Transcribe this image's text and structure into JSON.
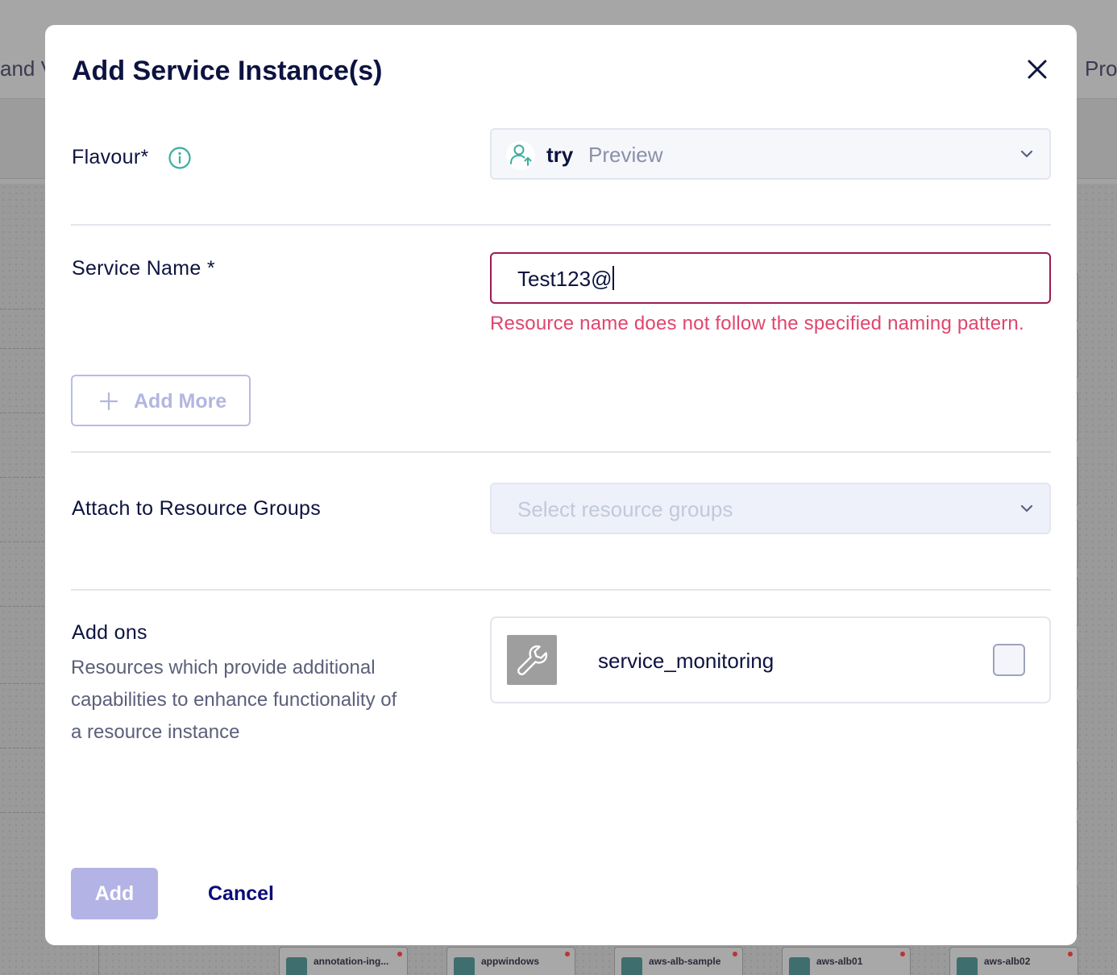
{
  "background": {
    "left_text": "and V",
    "right_text": "Pro",
    "nodes": [
      {
        "label": "annotation-ing..."
      },
      {
        "label": "appwindows"
      },
      {
        "label": "aws-alb-sample"
      },
      {
        "label": "aws-alb01"
      },
      {
        "label": "aws-alb02"
      }
    ]
  },
  "modal": {
    "title": "Add Service Instance(s)",
    "flavour": {
      "label": "Flavour*",
      "selected_name": "try",
      "selected_tag": "Preview"
    },
    "service_name": {
      "label": "Service Name *",
      "value": "Test123@",
      "error": "Resource name does not follow the specified naming pattern."
    },
    "add_more_label": "Add More",
    "resource_groups": {
      "label": "Attach to Resource Groups",
      "placeholder": "Select resource groups"
    },
    "addons": {
      "label": "Add ons",
      "description": "Resources which provide additional capabilities to enhance functionality of a resource instance",
      "items": [
        {
          "name": "service_monitoring",
          "checked": false
        }
      ]
    },
    "actions": {
      "add_label": "Add",
      "cancel_label": "Cancel"
    }
  },
  "colors": {
    "accent": "#0a0a7a",
    "error": "#e0456c",
    "input_error_border": "#9b1b53",
    "teal_icon": "#3aaea0",
    "disabled_button": "#b3b3e6"
  },
  "icons": [
    "close-icon",
    "info-icon",
    "user-upload-icon",
    "chevron-down-icon",
    "plus-icon",
    "wrench-icon"
  ]
}
